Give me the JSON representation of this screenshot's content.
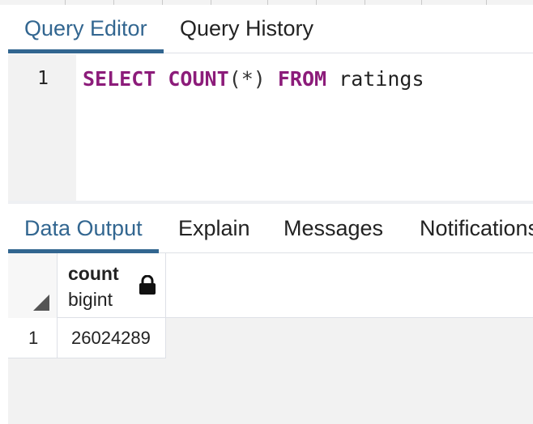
{
  "editor_tabs": [
    {
      "label": "Query Editor",
      "active": true
    },
    {
      "label": "Query History",
      "active": false
    }
  ],
  "editor": {
    "line_number": "1",
    "tokens": {
      "select": "SELECT",
      "count": "COUNT",
      "args": "(*)",
      "from": "FROM",
      "table": "ratings"
    }
  },
  "output_tabs": [
    {
      "label": "Data Output",
      "active": true
    },
    {
      "label": "Explain",
      "active": false
    },
    {
      "label": "Messages",
      "active": false
    },
    {
      "label": "Notifications",
      "active": false
    }
  ],
  "grid": {
    "columns": [
      {
        "name": "count",
        "type": "bigint",
        "icon": "lock-icon"
      }
    ],
    "rows": [
      {
        "row_number": "1",
        "values": [
          "26024289"
        ]
      }
    ]
  },
  "colors": {
    "accent": "#326690",
    "keyword": "#8c1c7a"
  }
}
